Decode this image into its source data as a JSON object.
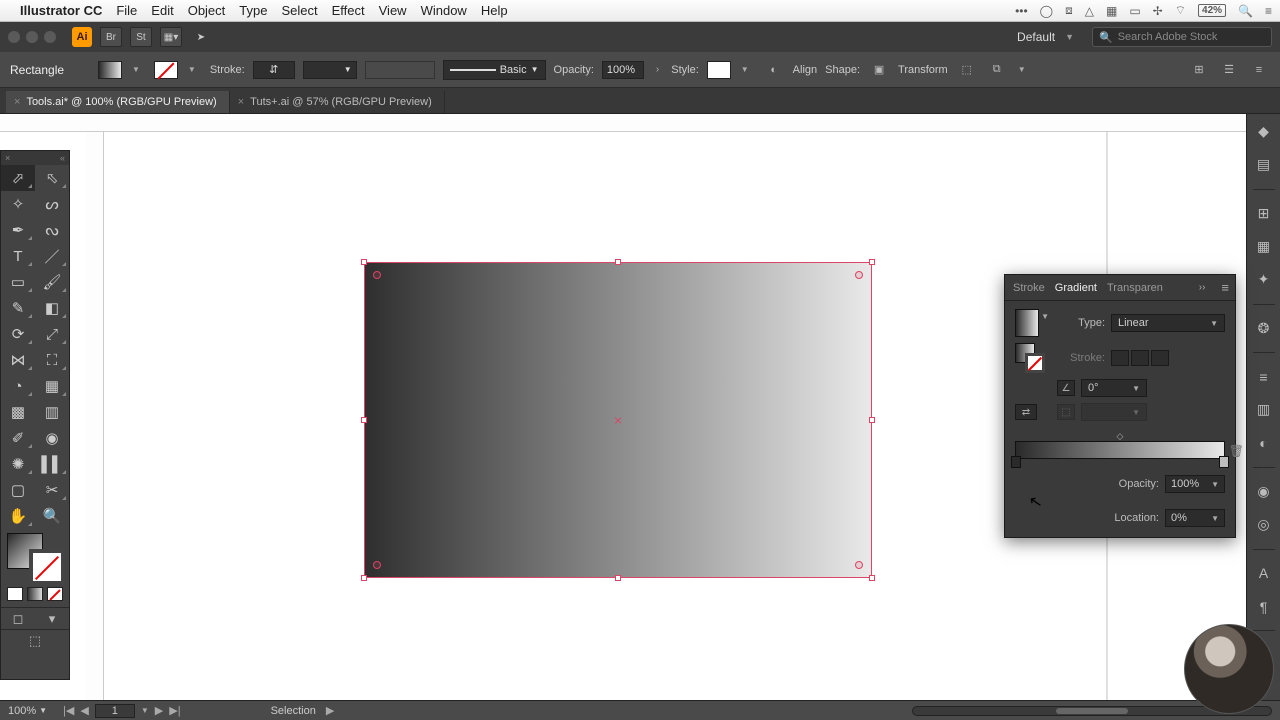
{
  "menubar": {
    "app": "Illustrator CC",
    "items": [
      "File",
      "Edit",
      "Object",
      "Type",
      "Select",
      "Effect",
      "View",
      "Window",
      "Help"
    ],
    "battery": "42%"
  },
  "titlebar": {
    "workspace": "Default",
    "search_placeholder": "Search Adobe Stock"
  },
  "control": {
    "selection": "Rectangle",
    "stroke_label": "Stroke:",
    "stroke_weight": "",
    "brush_label": "Basic",
    "opacity_label": "Opacity:",
    "opacity_value": "100%",
    "style_label": "Style:",
    "align_label": "Align",
    "shape_label": "Shape:",
    "transform_label": "Transform"
  },
  "tabs": [
    {
      "label": "Tools.ai* @ 100% (RGB/GPU Preview)",
      "active": true
    },
    {
      "label": "Tuts+.ai @ 57% (RGB/GPU Preview)",
      "active": false
    }
  ],
  "gradient_panel": {
    "tabs": [
      "Stroke",
      "Gradient",
      "Transparen"
    ],
    "active_tab": "Gradient",
    "type_label": "Type:",
    "type_value": "Linear",
    "stroke_label": "Stroke:",
    "angle_value": "0°",
    "opacity_label": "Opacity:",
    "opacity_value": "100%",
    "location_label": "Location:",
    "location_value": "0%"
  },
  "status": {
    "zoom": "100%",
    "artboard": "1",
    "tool": "Selection"
  }
}
